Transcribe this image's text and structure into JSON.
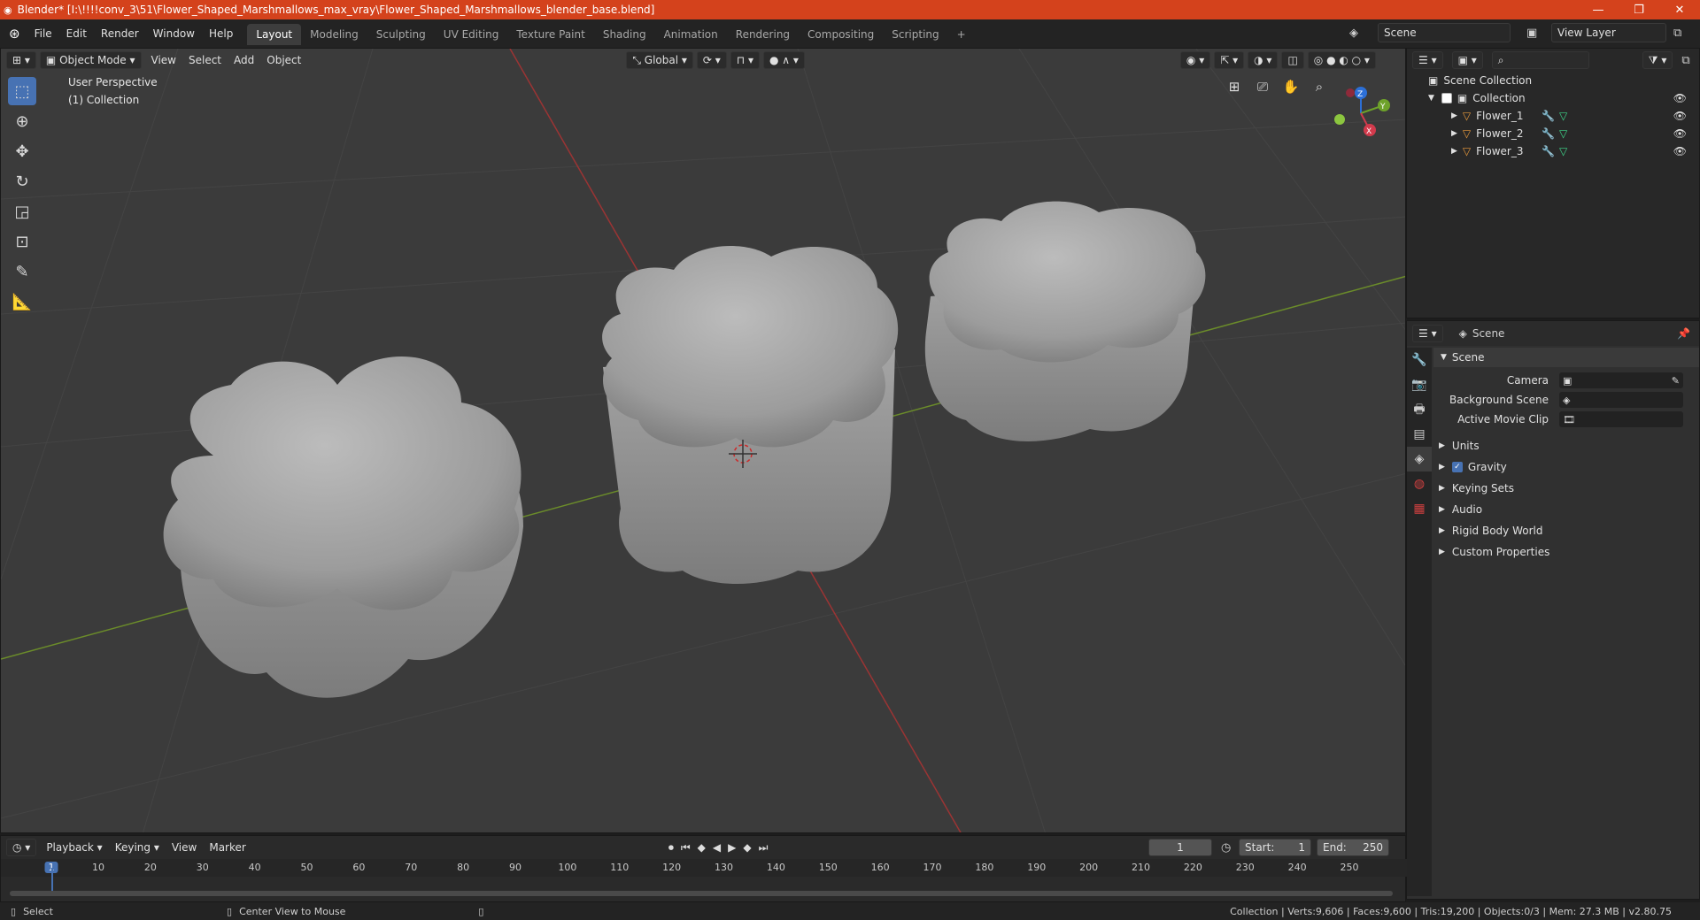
{
  "window": {
    "title": "Blender* [I:\\!!!!conv_3\\51\\Flower_Shaped_Marshmallows_max_vray\\Flower_Shaped_Marshmallows_blender_base.blend]",
    "minimize": "—",
    "maximize": "❐",
    "close": "✕"
  },
  "menu": [
    "File",
    "Edit",
    "Render",
    "Window",
    "Help"
  ],
  "workspaces": [
    "Layout",
    "Modeling",
    "Sculpting",
    "UV Editing",
    "Texture Paint",
    "Shading",
    "Animation",
    "Rendering",
    "Compositing",
    "Scripting"
  ],
  "workspace_add": "+",
  "scene_selector": "Scene",
  "view_layer": "View Layer",
  "viewport": {
    "mode": "Object Mode",
    "menus": [
      "View",
      "Select",
      "Add",
      "Object"
    ],
    "transform_orientation": "Global",
    "perspective_label": "User Perspective",
    "collection_label": "(1) Collection",
    "axis_labels": {
      "x": "X",
      "y": "Y",
      "z": "Z"
    }
  },
  "outliner": {
    "root": "Scene Collection",
    "collection": "Collection",
    "objects": [
      "Flower_1",
      "Flower_2",
      "Flower_3"
    ]
  },
  "properties": {
    "header": "Scene",
    "panel_title": "Scene",
    "fields": [
      {
        "label": "Camera",
        "value": ""
      },
      {
        "label": "Background Scene",
        "value": ""
      },
      {
        "label": "Active Movie Clip",
        "value": ""
      }
    ],
    "sections": [
      "Units",
      "Gravity",
      "Keying Sets",
      "Audio",
      "Rigid Body World",
      "Custom Properties"
    ],
    "gravity_checked": true
  },
  "timeline": {
    "menus": [
      "Playback",
      "Keying",
      "View",
      "Marker"
    ],
    "current_frame": "1",
    "start_label": "Start:",
    "start": "1",
    "end_label": "End:",
    "end": "250",
    "ticks": [
      "1",
      "10",
      "20",
      "30",
      "40",
      "50",
      "60",
      "70",
      "80",
      "90",
      "100",
      "110",
      "120",
      "130",
      "140",
      "150",
      "160",
      "170",
      "180",
      "190",
      "200",
      "210",
      "220",
      "230",
      "240",
      "250"
    ]
  },
  "status": {
    "left_action": "Select",
    "middle_action": "Center View to Mouse",
    "stats": "Collection | Verts:9,606 | Faces:9,600 | Tris:19,200 | Objects:0/3 | Mem: 27.3 MB | v2.80.75"
  }
}
